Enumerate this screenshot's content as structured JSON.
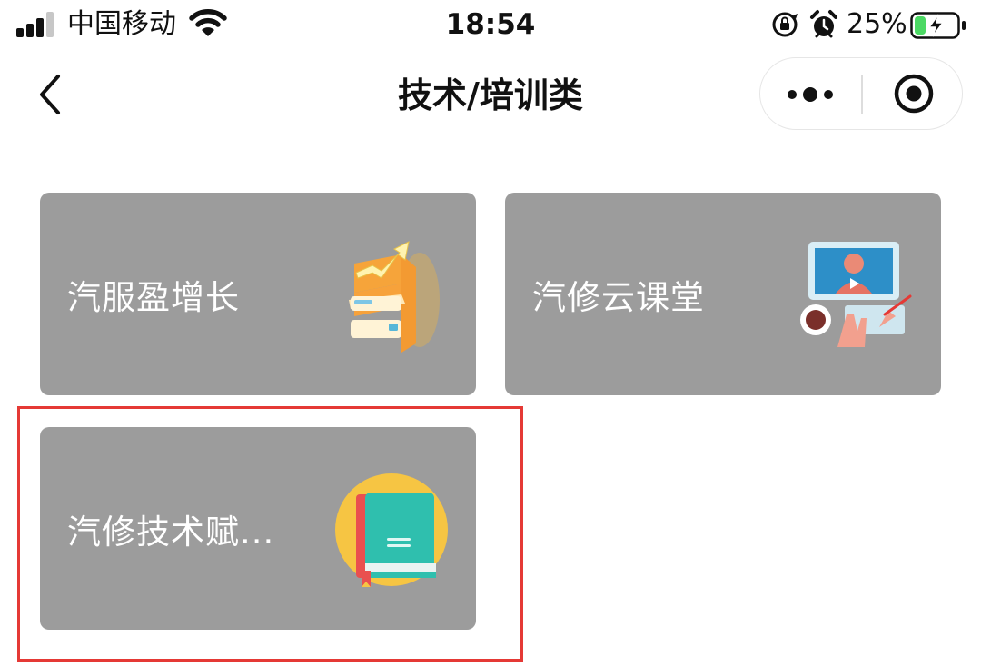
{
  "status_bar": {
    "carrier": "中国移动",
    "time": "18:54",
    "battery_percent": "25%",
    "battery_level": 0.25,
    "icons": [
      "signal-icon",
      "wifi-icon",
      "orientation-lock-icon",
      "alarm-icon",
      "battery-charging-icon"
    ]
  },
  "nav": {
    "title": "技术/培训类",
    "back_icon": "chevron-left-icon",
    "more_icon": "more-dots-icon",
    "close_icon": "target-close-icon"
  },
  "cards": [
    {
      "label": "汽服盈增长",
      "icon": "growth-chart-icon"
    },
    {
      "label": "汽修云课堂",
      "icon": "online-class-icon"
    },
    {
      "label": "汽修技术赋...",
      "icon": "book-icon",
      "highlighted": true
    }
  ],
  "colors": {
    "card_background": "#9c9c9c",
    "card_text": "#ffffff",
    "highlight_border": "#e53935",
    "battery_fill": "#4cd964"
  }
}
